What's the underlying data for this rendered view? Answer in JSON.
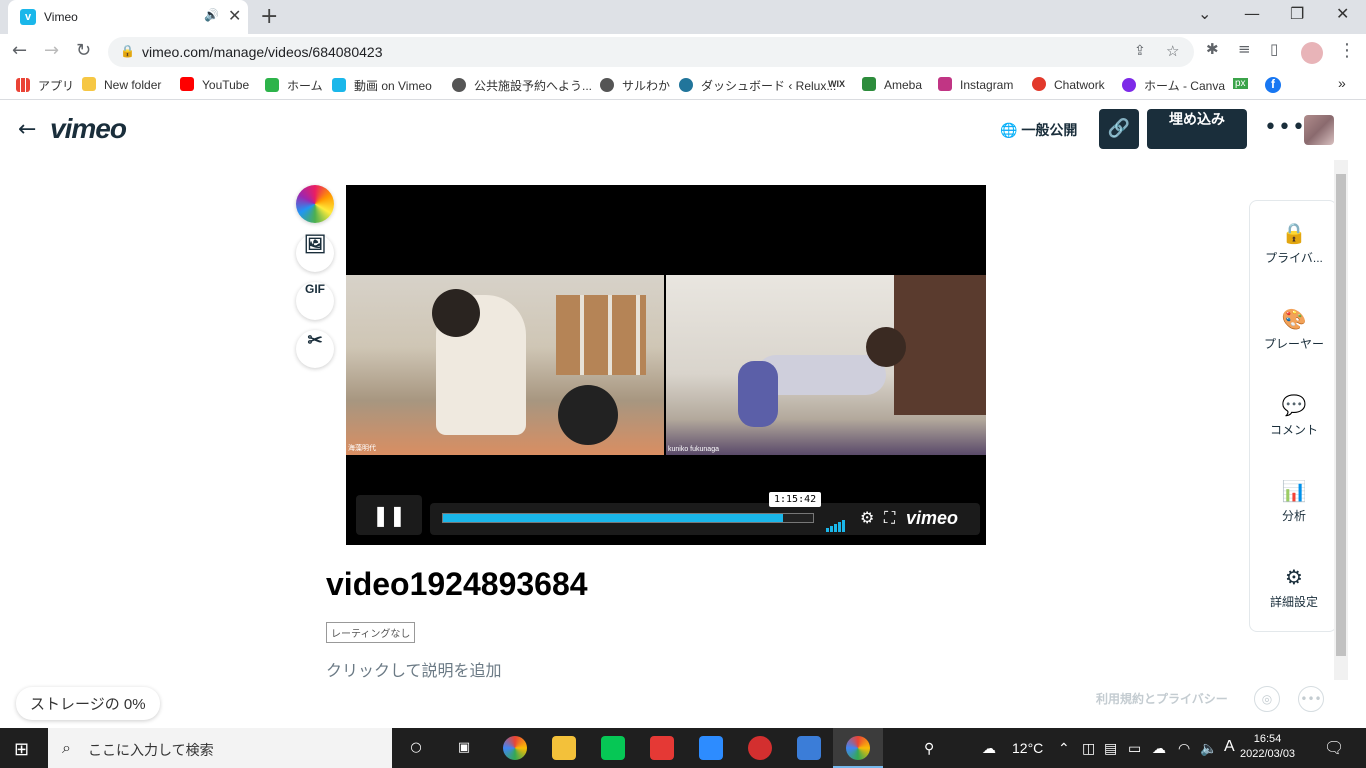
{
  "browser": {
    "tab_title": "Vimeo",
    "new_tab": "+",
    "url": "vimeo.com/manage/videos/684080423",
    "bookmarks": [
      {
        "label": "アプリ",
        "color": "#4285f4"
      },
      {
        "label": "New folder",
        "color": "#f6c744"
      },
      {
        "label": "YouTube",
        "color": "#ff0000"
      },
      {
        "label": "ホーム",
        "color": "#2db34a"
      },
      {
        "label": "動画 on Vimeo",
        "color": "#1ab7ea"
      },
      {
        "label": "公共施設予約へよう...",
        "color": "#555555"
      },
      {
        "label": "サルわか",
        "color": "#555555"
      },
      {
        "label": "ダッシュボード ‹ Relux...",
        "color": "#21759b"
      },
      {
        "label": "WIX",
        "color": "#ffffff"
      },
      {
        "label": "Ameba",
        "color": "#2d8c3c"
      },
      {
        "label": "Instagram",
        "color": "#c13584"
      },
      {
        "label": "Chatwork",
        "color": "#e2392b"
      },
      {
        "label": "ホーム - Canva",
        "color": "#7d2ae8"
      },
      {
        "label": "px",
        "color": "#3ba34a"
      },
      {
        "label": "f",
        "color": "#1877f2"
      }
    ]
  },
  "header": {
    "logo": "vimeo",
    "privacy_label": "一般公開",
    "embed_label": "埋め込み"
  },
  "tools": {
    "gif_label": "GIF"
  },
  "player": {
    "left_caption": "海藻明代",
    "right_caption": "kuniko fukunaga",
    "time_tooltip": "1:15:42",
    "progress": 0.92,
    "brand": "vimeo"
  },
  "video": {
    "title": "video1924893684",
    "rating": "レーティングなし",
    "description_placeholder": "クリックして説明を追加"
  },
  "sidebar": {
    "items": [
      {
        "label": "プライバ...",
        "icon": "lock-icon"
      },
      {
        "label": "プレーヤー",
        "icon": "palette-icon"
      },
      {
        "label": "コメント",
        "icon": "comment-icon"
      },
      {
        "label": "分析",
        "icon": "analytics-icon"
      },
      {
        "label": "詳細設定",
        "icon": "settings-icon"
      }
    ]
  },
  "footer": {
    "storage": "ストレージの 0%",
    "terms": "利用規約とプライバシー"
  },
  "taskbar": {
    "search_placeholder": "ここに入力して検索",
    "weather": "12°C",
    "ime": "A",
    "time": "16:54",
    "date": "2022/03/03"
  }
}
